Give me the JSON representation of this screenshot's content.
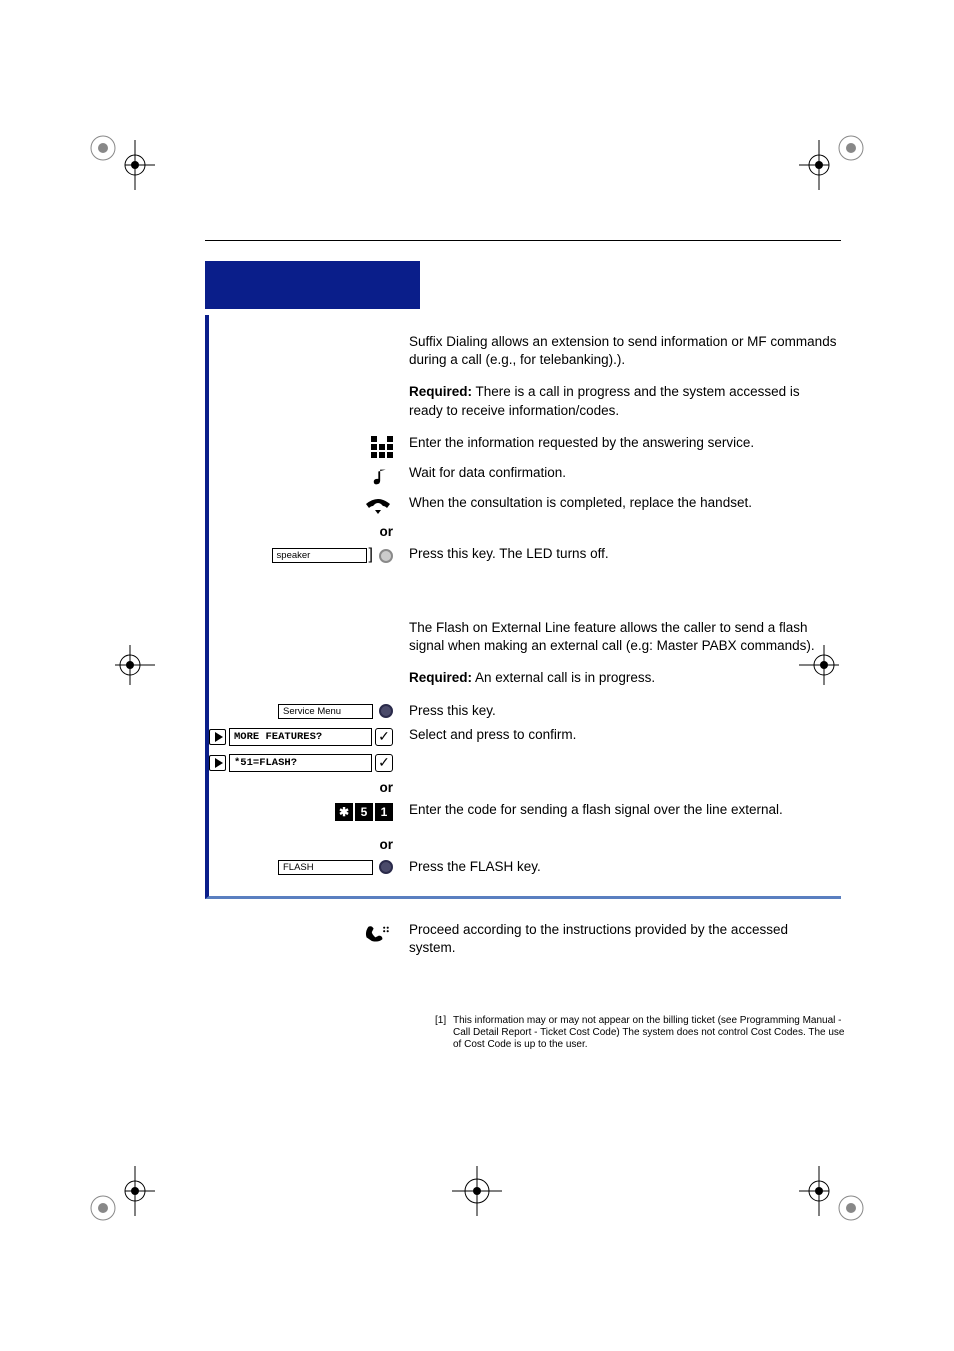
{
  "section1": {
    "intro": "Suffix Dialing allows an extension to send information or MF commands during a call (e.g.,  for telebanking).).",
    "required_label": "Required:",
    "required_text": " There is a call in progress and the system accessed is ready to receive information/codes.",
    "step1": "Enter the information requested by the answering service.",
    "step2": "Wait for data confirmation.",
    "step3": "When the consultation is completed, replace the handset.",
    "or": "or",
    "speaker_key": "speaker",
    "speaker_desc": "Press this key. The LED turns off."
  },
  "section2": {
    "intro": "The Flash on External Line feature allows the caller to send a flash signal when making an external call (e.g: Master PABX commands).",
    "required_label": "Required:",
    "required_text": " An external call is in progress.",
    "service_menu_key": "Service Menu",
    "service_menu_desc": "Press this key.",
    "more_features": "MORE FEATURES?",
    "more_features_desc": "Select and press to confirm.",
    "flash_option": "*51=FLASH?",
    "or": "or",
    "code_digits": [
      "✱",
      "5",
      "1"
    ],
    "code_desc": "Enter the code for sending a flash signal over the line external.",
    "flash_key": "FLASH",
    "flash_desc": "Press the FLASH key.",
    "proceed": "Proceed according to the instructions provided by the accessed system."
  },
  "footnote": {
    "num": "[1]",
    "text": "This information may or may not appear on the billing ticket (see Programming Manual - Call Detail Report - Ticket Cost Code) The system does not control Cost Codes.  The use of Cost Code is up to the user."
  }
}
